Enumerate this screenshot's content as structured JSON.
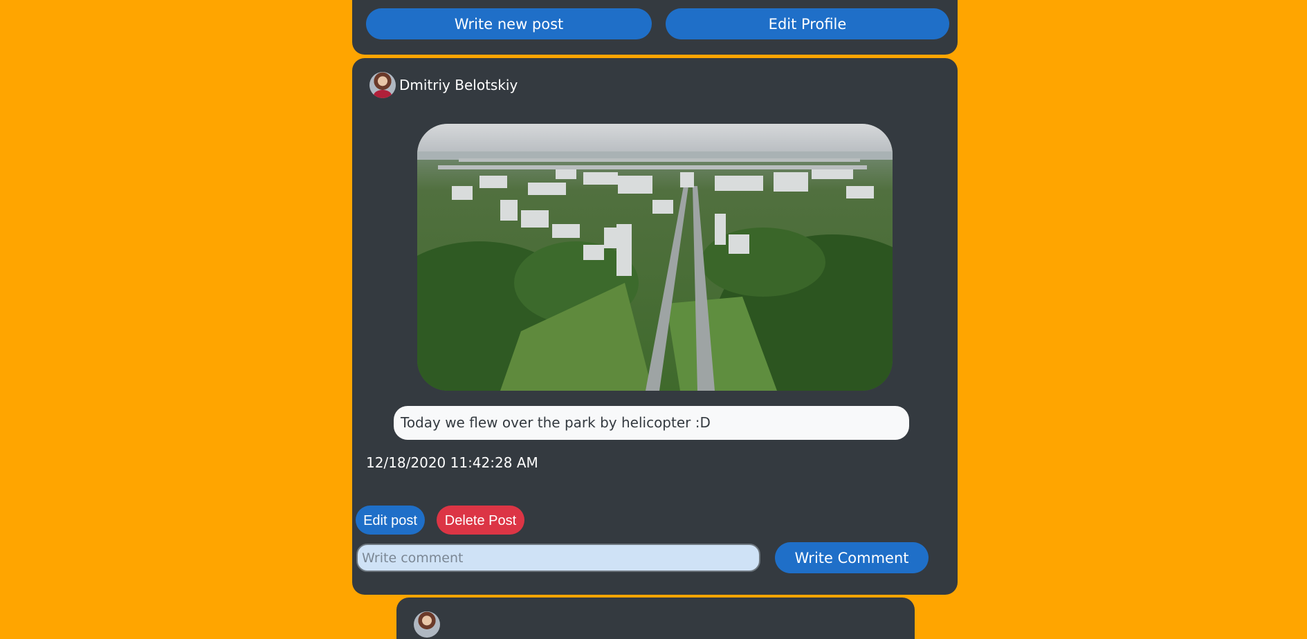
{
  "top_bar": {
    "write_new_post_label": "Write new post",
    "edit_profile_label": "Edit Profile"
  },
  "post": {
    "author_name": "Dmitriy Belotskiy",
    "image_description_icon": "aerial-city-photo",
    "caption": "Today we flew over the park by helicopter :D",
    "timestamp": "12/18/2020 11:42:28 AM",
    "edit_post_label": "Edit post",
    "delete_post_label": "Delete Post",
    "comment_placeholder": "Write comment",
    "write_comment_label": "Write Comment"
  },
  "colors": {
    "page_background": "#FFA500",
    "card_background": "#343a40",
    "primary_button": "#1f6fc8",
    "danger_button": "#dc3545"
  }
}
